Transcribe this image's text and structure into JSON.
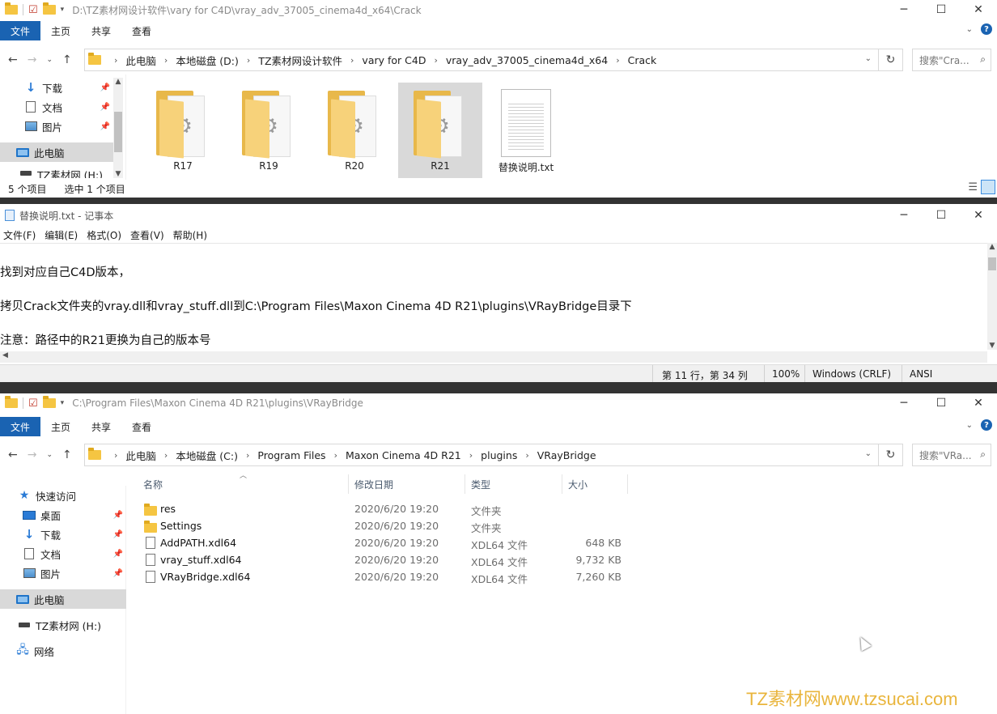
{
  "explorer1": {
    "path_title": "D:\\TZ素材网设计软件\\vary for C4D\\vray_adv_37005_cinema4d_x64\\Crack",
    "ribbon_tabs": [
      "文件",
      "主页",
      "共享",
      "查看"
    ],
    "breadcrumb": [
      "此电脑",
      "本地磁盘 (D:)",
      "TZ素材网设计软件",
      "vary for C4D",
      "vray_adv_37005_cinema4d_x64",
      "Crack"
    ],
    "search_placeholder": "搜索\"Cra...",
    "nav_items": [
      {
        "label": "下载",
        "icon": "download-icon"
      },
      {
        "label": "文档",
        "icon": "document-icon"
      },
      {
        "label": "图片",
        "icon": "pictures-icon"
      },
      {
        "label": "此电脑",
        "icon": "computer-icon"
      },
      {
        "label": "TZ素材网 (H:)",
        "icon": "drive-icon"
      }
    ],
    "tiles": [
      {
        "label": "R17",
        "kind": "folder"
      },
      {
        "label": "R19",
        "kind": "folder"
      },
      {
        "label": "R20",
        "kind": "folder"
      },
      {
        "label": "R21",
        "kind": "folder",
        "selected": true
      },
      {
        "label": "替换说明.txt",
        "kind": "text"
      }
    ],
    "status_count": "5 个项目",
    "status_selected": "选中 1 个项目"
  },
  "notepad": {
    "title": "替换说明.txt - 记事本",
    "menu": [
      "文件(F)",
      "编辑(E)",
      "格式(O)",
      "查看(V)",
      "帮助(H)"
    ],
    "lines": [
      "找到对应自己C4D版本，",
      "拷贝Crack文件夹的vray.dll和vray_stuff.dll到C:\\Program Files\\Maxon Cinema 4D R21\\plugins\\VRayBridge目录下",
      "注意：路径中的R21更换为自己的版本号"
    ],
    "status": {
      "position": "第 11 行，第 34 列",
      "zoom": "100%",
      "eol": "Windows (CRLF)",
      "encoding": "ANSI"
    }
  },
  "explorer2": {
    "path_title": "C:\\Program Files\\Maxon Cinema 4D R21\\plugins\\VRayBridge",
    "ribbon_tabs": [
      "文件",
      "主页",
      "共享",
      "查看"
    ],
    "breadcrumb": [
      "此电脑",
      "本地磁盘 (C:)",
      "Program Files",
      "Maxon Cinema 4D R21",
      "plugins",
      "VRayBridge"
    ],
    "search_placeholder": "搜索\"VRa...",
    "nav_items": [
      {
        "label": "快速访问",
        "icon": "star-icon"
      },
      {
        "label": "桌面",
        "icon": "desktop-icon"
      },
      {
        "label": "下载",
        "icon": "download-icon"
      },
      {
        "label": "文档",
        "icon": "document-icon"
      },
      {
        "label": "图片",
        "icon": "pictures-icon"
      },
      {
        "label": "此电脑",
        "icon": "computer-icon"
      },
      {
        "label": "TZ素材网 (H:)",
        "icon": "drive-icon"
      },
      {
        "label": "网络",
        "icon": "network-icon"
      }
    ],
    "columns": [
      "名称",
      "修改日期",
      "类型",
      "大小"
    ],
    "files": [
      {
        "name": "res",
        "date": "2020/6/20 19:20",
        "type": "文件夹",
        "size": "",
        "kind": "folder"
      },
      {
        "name": "Settings",
        "date": "2020/6/20 19:20",
        "type": "文件夹",
        "size": "",
        "kind": "folder"
      },
      {
        "name": "AddPATH.xdl64",
        "date": "2020/6/20 19:20",
        "type": "XDL64 文件",
        "size": "648 KB",
        "kind": "file"
      },
      {
        "name": "vray_stuff.xdl64",
        "date": "2020/6/20 19:20",
        "type": "XDL64 文件",
        "size": "9,732 KB",
        "kind": "file"
      },
      {
        "name": "VRayBridge.xdl64",
        "date": "2020/6/20 19:20",
        "type": "XDL64 文件",
        "size": "7,260 KB",
        "kind": "file"
      }
    ]
  },
  "watermark": "TZ素材网www.tzsucai.com",
  "colors": {
    "accent": "#1a63b2",
    "folder": "#f5c542",
    "watermark": "#e9b53c",
    "selection": "#d9d9d9"
  }
}
